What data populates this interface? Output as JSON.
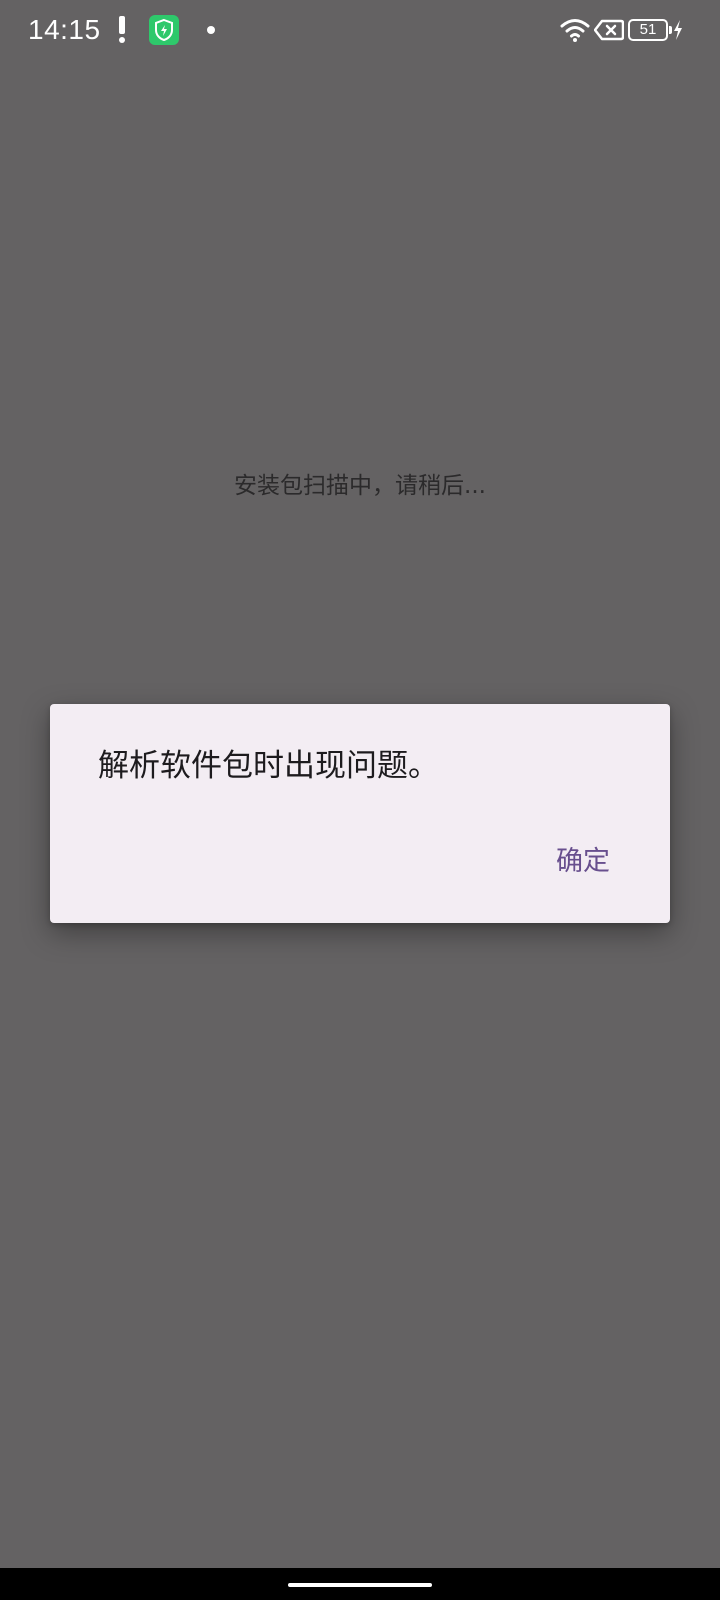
{
  "status_bar": {
    "time": "14:15",
    "battery_level": "51",
    "icons": [
      "alert-icon",
      "shield-app-icon",
      "notification-dot-icon",
      "wifi-icon",
      "no-sim-icon",
      "battery-icon",
      "charging-bolt-icon"
    ]
  },
  "screen": {
    "scan_message": "安装包扫描中，请稍后..."
  },
  "dialog": {
    "message": "解析软件包时出现问题。",
    "ok_label": "确定"
  },
  "colors": {
    "overlay_background": "#646263",
    "dialog_background": "#f3edf3",
    "dialog_text": "#1d1b1e",
    "accent": "#684f8e",
    "shield_icon": "#2ec86b"
  }
}
